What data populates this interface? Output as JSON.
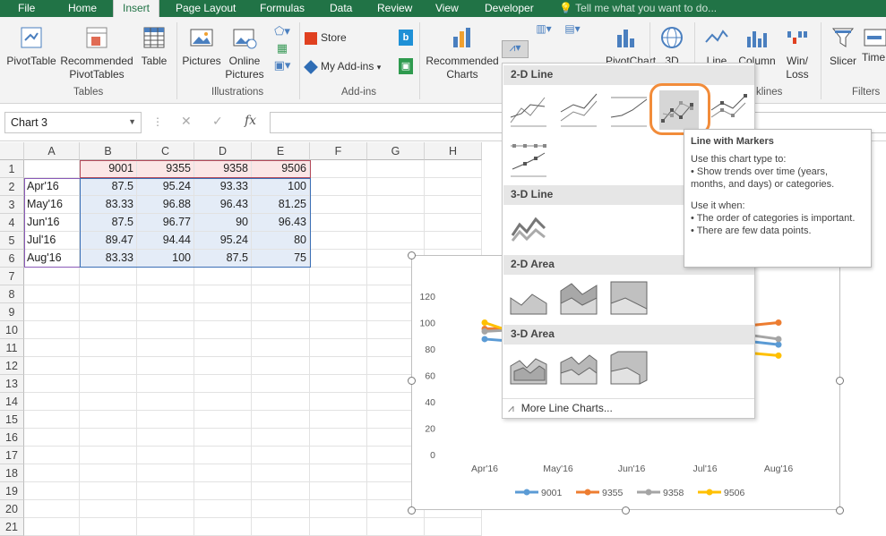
{
  "tabs": {
    "file": "File",
    "home": "Home",
    "insert": "Insert",
    "page_layout": "Page Layout",
    "formulas": "Formulas",
    "data": "Data",
    "review": "Review",
    "view": "View",
    "developer": "Developer",
    "tell_me": "Tell me what you want to do..."
  },
  "ribbon": {
    "pivot_table": "PivotTable",
    "recommended_pivot_1": "Recommended",
    "recommended_pivot_2": "PivotTables",
    "table": "Table",
    "pictures": "Pictures",
    "online_pictures_1": "Online",
    "online_pictures_2": "Pictures",
    "store": "Store",
    "my_addins": "My Add-ins",
    "recommended_charts_1": "Recommended",
    "recommended_charts_2": "Charts",
    "pivot_chart": "PivotChart",
    "map_3d": "3D",
    "line": "Line",
    "column": "Column",
    "winloss_1": "Win/",
    "winloss_2": "Loss",
    "slicer": "Slicer",
    "timeline": "Time",
    "group_tables": "Tables",
    "group_illustrations": "Illustrations",
    "group_addins": "Add-ins",
    "group_sparklines": "klines",
    "group_filters": "Filters"
  },
  "namebox": "Chart 3",
  "formula_icons": {
    "cancel": "✕",
    "enter": "✓",
    "fx": "fx"
  },
  "columns": [
    "A",
    "B",
    "C",
    "D",
    "E",
    "F",
    "G",
    "H"
  ],
  "rows": [
    "1",
    "2",
    "3",
    "4",
    "5",
    "6",
    "7",
    "8",
    "9",
    "10",
    "11",
    "12",
    "13",
    "14",
    "15",
    "16",
    "17",
    "18",
    "19",
    "20",
    "21"
  ],
  "table": {
    "headers": [
      "9001",
      "9355",
      "9358",
      "9506"
    ],
    "rows": [
      {
        "label": "Apr'16",
        "values": [
          "87.5",
          "95.24",
          "93.33",
          "100"
        ]
      },
      {
        "label": "May'16",
        "values": [
          "83.33",
          "96.88",
          "96.43",
          "81.25"
        ]
      },
      {
        "label": "Jun'16",
        "values": [
          "87.5",
          "96.77",
          "90",
          "96.43"
        ]
      },
      {
        "label": "Jul'16",
        "values": [
          "89.47",
          "94.44",
          "95.24",
          "80"
        ]
      },
      {
        "label": "Aug'16",
        "values": [
          "83.33",
          "100",
          "87.5",
          "75"
        ]
      }
    ]
  },
  "gallery": {
    "sec_2d_line": "2-D Line",
    "sec_3d_line": "3-D Line",
    "sec_2d_area": "2-D Area",
    "sec_3d_area": "3-D Area",
    "more": "More Line Charts..."
  },
  "tooltip": {
    "title": "Line with Markers",
    "line1": "Use this chart type to:",
    "line2": "• Show trends over time (years, months, and days) or categories.",
    "line3": "Use it when:",
    "line4": "• The order of categories is important.",
    "line5": "• There are few data points."
  },
  "colors": {
    "excel_green": "#217346",
    "s9001": "#5b9bd5",
    "s9355": "#ed7d31",
    "s9358": "#a5a5a5",
    "s9506": "#ffc000",
    "highlight": "#f28c3a"
  },
  "chart_data": {
    "type": "line",
    "categories": [
      "Apr'16",
      "May'16",
      "Jun'16",
      "Jul'16",
      "Aug'16"
    ],
    "ylim": [
      0,
      120
    ],
    "yticks": [
      "0",
      "20",
      "40",
      "60",
      "80",
      "100",
      "120"
    ],
    "series": [
      {
        "name": "9001",
        "values": [
          87.5,
          83.33,
          87.5,
          89.47,
          83.33
        ]
      },
      {
        "name": "9355",
        "values": [
          95.24,
          96.88,
          96.77,
          94.44,
          100
        ]
      },
      {
        "name": "9358",
        "values": [
          93.33,
          96.43,
          90,
          95.24,
          87.5
        ]
      },
      {
        "name": "9506",
        "values": [
          100,
          81.25,
          96.43,
          80,
          75
        ]
      }
    ],
    "legend": "bottom",
    "grid": false
  }
}
